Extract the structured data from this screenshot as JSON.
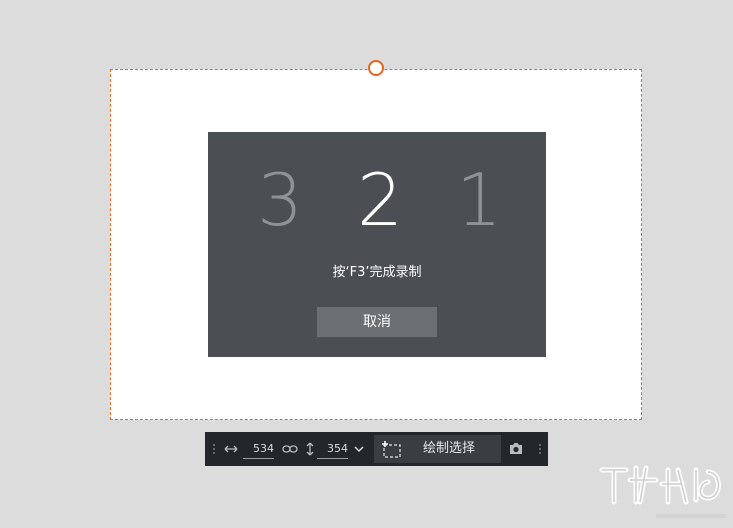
{
  "countdown": {
    "digits": [
      {
        "value": "3",
        "state": "past"
      },
      {
        "value": "2",
        "state": "active"
      },
      {
        "value": "1",
        "state": "upcoming"
      }
    ],
    "hint": "按‘F3’完成录制",
    "cancel_label": "取消"
  },
  "toolbar": {
    "width_value": "534",
    "height_value": "354",
    "draw_select_label": "绘制选择"
  },
  "colors": {
    "selection_border": "#e8641e",
    "panel_bg": "#4b4e53",
    "toolbar_bg": "#23262b",
    "digit_active": "#ffffff",
    "digit_inactive": "#8e9195"
  },
  "icons": {
    "width": "horizontal-arrows-icon",
    "link": "link-icon",
    "height": "vertical-arrows-icon",
    "dropdown": "chevron-down-icon",
    "draw": "draw-selection-icon",
    "camera": "camera-icon"
  }
}
